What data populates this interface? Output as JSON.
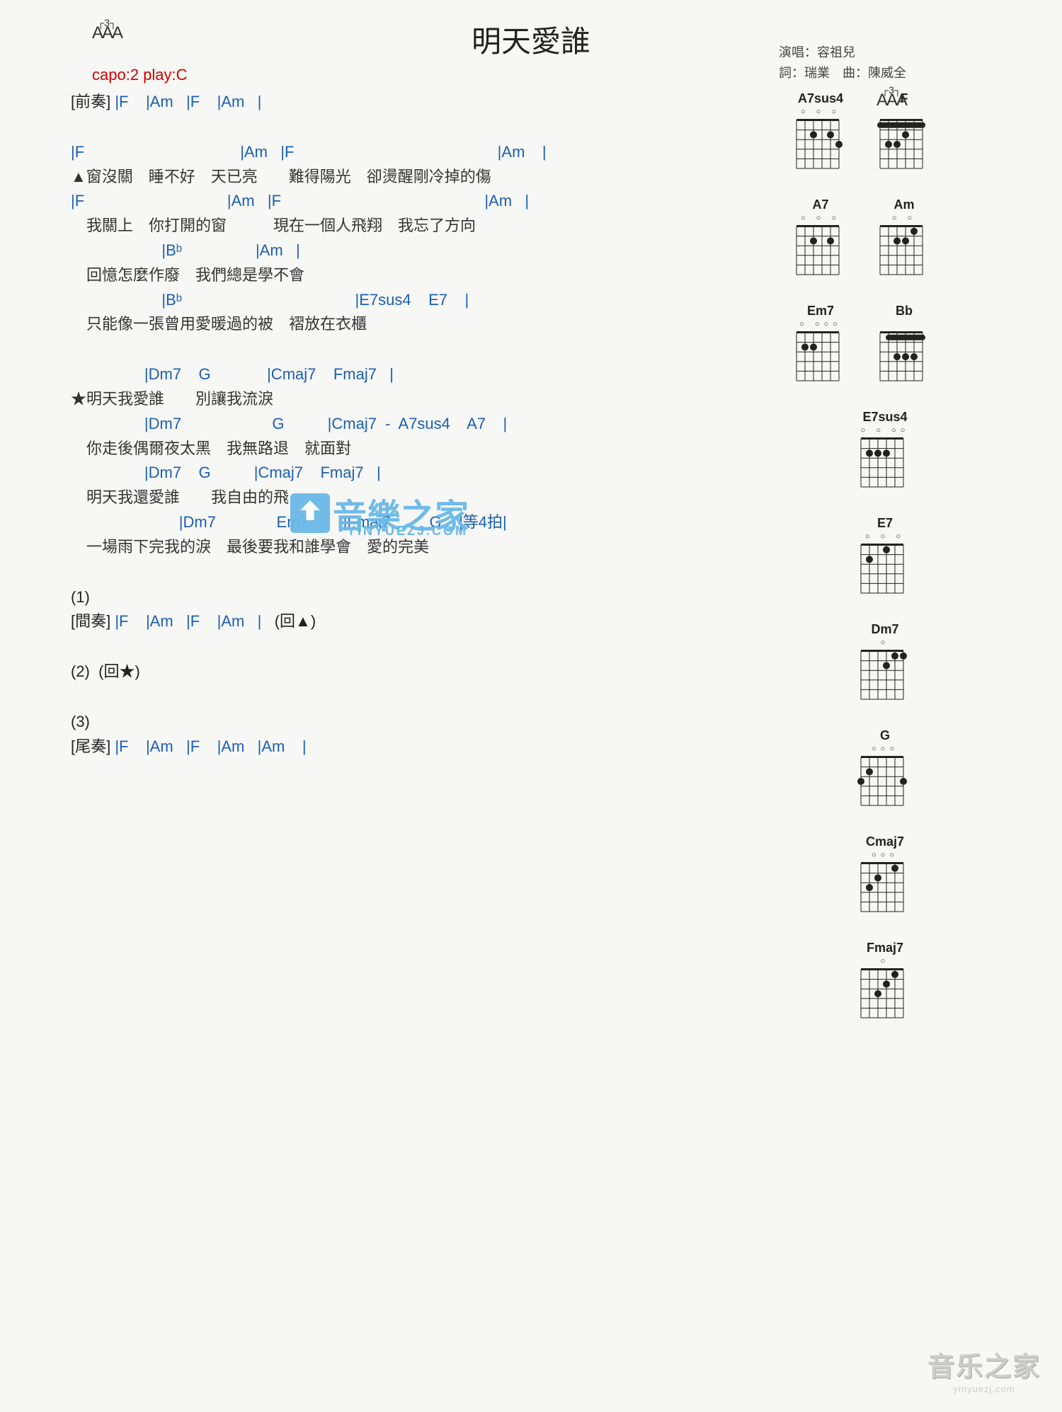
{
  "title": "明天愛誰",
  "meta": {
    "singer_label": "演唱：容祖兒",
    "credits": "詞：瑞業　曲：陳威全"
  },
  "capo_text": "capo:2 play:C",
  "capo_icon": {
    "top": "┌3┐",
    "body": "AAA"
  },
  "lines": [
    {
      "chords": "[前奏] |F    |Am   |F    |Am   |",
      "lyric": "",
      "section": true
    },
    {
      "gap": "big"
    },
    {
      "chords": "|F                                    |Am   |F                                               |Am    |",
      "lyric": "▲窗沒關　睡不好　天已亮　　難得陽光　卻燙醒剛冷掉的傷"
    },
    {
      "chords": "|F                                 |Am   |F                                               |Am   |",
      "lyric": "　我關上　你打開的窗　　　現在一個人飛翔　我忘了方向"
    },
    {
      "chords": "                     |Bᵇ                 |Am   |",
      "lyric": "　回憶怎麼作廢　我們總是學不會"
    },
    {
      "chords": "                     |Bᵇ                                        |E7sus4    E7    |",
      "lyric": "　只能像一張曾用愛暖過的被　褶放在衣櫃"
    },
    {
      "gap": "big"
    },
    {
      "chords": "                 |Dm7    G             |Cmaj7    Fmaj7   |",
      "lyric": "★明天我愛誰　　別讓我流淚"
    },
    {
      "chords": "                 |Dm7                     G          |Cmaj7  -  A7sus4    A7    |",
      "lyric": "　你走後偶爾夜太黑　我無路退　就面對"
    },
    {
      "chords": "                 |Dm7    G          |Cmaj7    Fmaj7   |",
      "lyric": "　明天我還愛誰　　我自由的飛"
    },
    {
      "chords": "                         |Dm7              Em7        |Fmaj7         G    |等4拍|",
      "lyric": "　一場雨下完我的淚　最後要我和誰學會　愛的完美"
    },
    {
      "gap": "big"
    },
    {
      "chords": "(1)",
      "lyric": "",
      "section": true
    },
    {
      "chords": "[間奏] |F    |Am   |F    |Am   |   (回▲)",
      "lyric": "",
      "section": true
    },
    {
      "gap": "big"
    },
    {
      "chords": "(2)  (回★)",
      "lyric": "",
      "section": true
    },
    {
      "gap": "big"
    },
    {
      "chords": "(3)",
      "lyric": "",
      "section": true
    },
    {
      "chords": "[尾奏] |F    |Am   |F    |Am   |Am    |",
      "lyric": "",
      "section": true
    }
  ],
  "chord_diagrams": [
    [
      {
        "name": "A7sus4",
        "open": " ○   ○ ○",
        "fret": "",
        "dots": [
          {
            "s": 2,
            "f": 2
          },
          {
            "s": 4,
            "f": 2
          },
          {
            "s": 1,
            "f": 3
          }
        ]
      },
      {
        "name": "F",
        "open": "",
        "fret": "",
        "barre": {
          "f": 1,
          "from": 1,
          "to": 6
        },
        "dots": [
          {
            "s": 3,
            "f": 2
          },
          {
            "s": 4,
            "f": 3
          },
          {
            "s": 5,
            "f": 3
          }
        ]
      }
    ],
    [
      {
        "name": "A7",
        "open": " ○   ○ ○",
        "fret": "",
        "dots": [
          {
            "s": 2,
            "f": 2
          },
          {
            "s": 4,
            "f": 2
          }
        ]
      },
      {
        "name": "Am",
        "open": " ○       ○",
        "fret": "",
        "dots": [
          {
            "s": 2,
            "f": 1
          },
          {
            "s": 3,
            "f": 2
          },
          {
            "s": 4,
            "f": 2
          }
        ]
      }
    ],
    [
      {
        "name": "Em7",
        "open": "○     ○○○",
        "fret": "",
        "dots": [
          {
            "s": 5,
            "f": 2
          },
          {
            "s": 4,
            "f": 2
          }
        ]
      },
      {
        "name": "Bb",
        "open": "",
        "fret": "",
        "barre": {
          "f": 1,
          "from": 1,
          "to": 5
        },
        "dots": [
          {
            "s": 2,
            "f": 3
          },
          {
            "s": 3,
            "f": 3
          },
          {
            "s": 4,
            "f": 3
          }
        ]
      }
    ],
    [
      {
        "name": "E7sus4",
        "open": "○   ○ ○○",
        "fret": "",
        "dots": [
          {
            "s": 5,
            "f": 2
          },
          {
            "s": 4,
            "f": 2
          },
          {
            "s": 3,
            "f": 2
          }
        ]
      }
    ],
    [
      {
        "name": "E7",
        "open": "○     ○ ○",
        "fret": "",
        "dots": [
          {
            "s": 3,
            "f": 1
          },
          {
            "s": 5,
            "f": 2
          }
        ]
      }
    ],
    [
      {
        "name": "Dm7",
        "open": "     ○",
        "fret": "",
        "dots": [
          {
            "s": 1,
            "f": 1
          },
          {
            "s": 2,
            "f": 1
          },
          {
            "s": 3,
            "f": 2
          }
        ]
      }
    ],
    [
      {
        "name": "G",
        "open": "   ○○○",
        "fret": "",
        "dots": [
          {
            "s": 5,
            "f": 2
          },
          {
            "s": 6,
            "f": 3
          },
          {
            "s": 1,
            "f": 3
          }
        ]
      }
    ],
    [
      {
        "name": "Cmaj7",
        "open": "   ○○○",
        "fret": "",
        "dots": [
          {
            "s": 4,
            "f": 2
          },
          {
            "s": 5,
            "f": 3
          },
          {
            "s": 2,
            "f": 1
          }
        ],
        "openrow": "    ○○○"
      }
    ],
    [
      {
        "name": "Fmaj7",
        "open": "          ○",
        "fret": "",
        "dots": [
          {
            "s": 2,
            "f": 1
          },
          {
            "s": 3,
            "f": 2
          },
          {
            "s": 4,
            "f": 3
          }
        ]
      }
    ]
  ],
  "watermark": {
    "text": "音樂之家",
    "sub": "YINYUEZJ.COM"
  },
  "footer": {
    "big": "音乐之家",
    "small": "yinyuezj.com"
  }
}
